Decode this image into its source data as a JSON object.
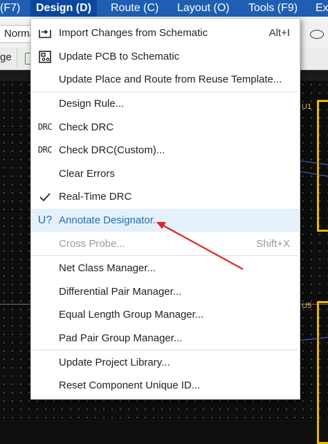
{
  "menubar": {
    "items": [
      {
        "label": "(F7)"
      },
      {
        "label": "Design (D)",
        "active": true
      },
      {
        "label": "Route (C)"
      },
      {
        "label": "Layout (O)"
      },
      {
        "label": "Tools (F9)"
      },
      {
        "label": "Ex"
      }
    ]
  },
  "toolbar": {
    "unit_select_value": "Norma",
    "page_label": "ge"
  },
  "canvas": {
    "component_labels": [
      "U1",
      "U5"
    ]
  },
  "menu": {
    "items": [
      {
        "icon": "import-changes-icon",
        "label": "Import Changes from Schematic",
        "shortcut": "Alt+I"
      },
      {
        "icon": "update-pcb-icon",
        "label": "Update PCB to Schematic",
        "shortcut": ""
      },
      {
        "icon": "",
        "label": "Update Place and Route from Reuse Template...",
        "shortcut": ""
      },
      {
        "icon": "",
        "label": "Design Rule...",
        "shortcut": ""
      },
      {
        "icon": "drc-icon",
        "icon_text": "DRC",
        "label": "Check DRC",
        "shortcut": ""
      },
      {
        "icon": "drc-icon",
        "icon_text": "DRC",
        "label": "Check DRC(Custom)...",
        "shortcut": ""
      },
      {
        "icon": "",
        "label": "Clear Errors",
        "shortcut": ""
      },
      {
        "icon": "checkmark-icon",
        "label": "Real-Time DRC",
        "shortcut": "",
        "checked": true
      },
      {
        "icon": "annotate-designator-icon",
        "icon_text": "U?",
        "label": "Annotate Designator...",
        "shortcut": "",
        "highlighted": true
      },
      {
        "icon": "",
        "label": "Cross Probe...",
        "shortcut": "Shift+X",
        "disabled": true
      },
      {
        "icon": "",
        "label": "Net Class Manager...",
        "shortcut": ""
      },
      {
        "icon": "",
        "label": "Differential Pair Manager...",
        "shortcut": ""
      },
      {
        "icon": "",
        "label": "Equal Length Group Manager...",
        "shortcut": ""
      },
      {
        "icon": "",
        "label": "Pad Pair Group Manager...",
        "shortcut": ""
      },
      {
        "icon": "",
        "label": "Update Project Library...",
        "shortcut": ""
      },
      {
        "icon": "",
        "label": "Reset Component Unique ID...",
        "shortcut": ""
      }
    ]
  },
  "colors": {
    "menubar_bg": "#1f5eb2",
    "menubar_active_bg": "#0b47a0",
    "highlight_bg": "#e4f1fb",
    "highlight_text": "#1c6fb8",
    "annotation_arrow": "#e02424",
    "component_outline": "#e8b800"
  }
}
